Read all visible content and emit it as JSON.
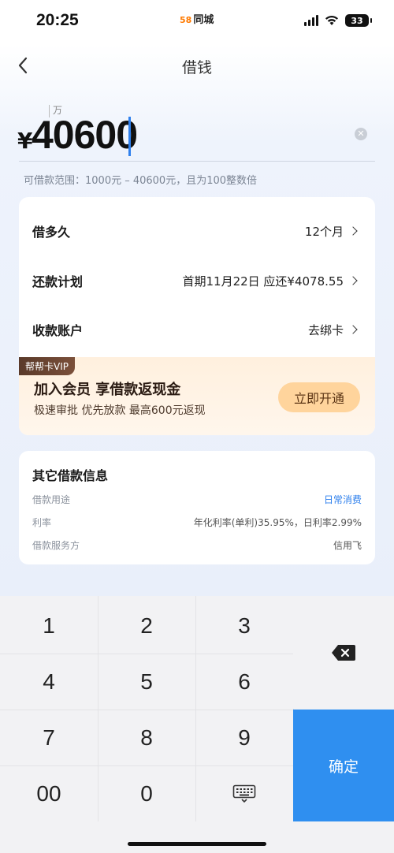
{
  "status_bar": {
    "time": "20:25",
    "carrier_logo": "58",
    "carrier": "同城",
    "battery": "33"
  },
  "nav": {
    "title": "借钱",
    "back_icon": "chevron-left-icon"
  },
  "amount": {
    "unit_hint": "万",
    "currency": "¥",
    "value": "40600",
    "range_hint": "可借款范围：1000元 – 40600元，且为100整数倍"
  },
  "rows": [
    {
      "label": "借多久",
      "value": "12个月"
    },
    {
      "label": "还款计划",
      "value": "首期11月22日 应还¥4078.55"
    },
    {
      "label": "收款账户",
      "value": "去绑卡"
    }
  ],
  "vip": {
    "tag": "帮帮卡VIP",
    "title": "加入会员  享借款返现金",
    "subtitle": "极速审批 优先放款 最高600元返现",
    "button": "立即开通"
  },
  "info": {
    "title": "其它借款信息",
    "items": [
      {
        "label": "借款用途",
        "value": "日常消费"
      },
      {
        "label": "利率",
        "value": "年化利率(单利)35.95%，日利率2.99%"
      },
      {
        "label": "借款服务方",
        "value": "信用飞"
      }
    ]
  },
  "keypad": {
    "keys": [
      "1",
      "2",
      "3",
      "4",
      "5",
      "6",
      "7",
      "8",
      "9",
      "00",
      "0"
    ],
    "confirm": "确定",
    "backspace_icon": "backspace-icon",
    "keyboard_icon": "keyboard-icon"
  },
  "colors": {
    "accent": "#2f8ff0",
    "link": "#2f80ed",
    "vip_button": "#ffd49c",
    "vip_tag": "#5a3a2a"
  }
}
